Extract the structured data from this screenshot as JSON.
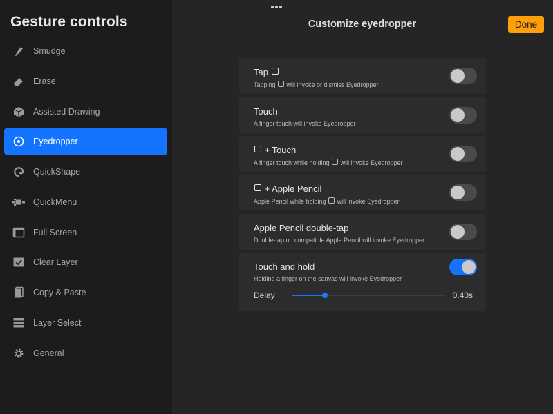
{
  "sidebar": {
    "title": "Gesture controls",
    "items": [
      {
        "label": "Smudge",
        "icon": "smudge-icon"
      },
      {
        "label": "Erase",
        "icon": "eraser-icon"
      },
      {
        "label": "Assisted Drawing",
        "icon": "cube-icon"
      },
      {
        "label": "Eyedropper",
        "icon": "eyedropper-icon",
        "active": true
      },
      {
        "label": "QuickShape",
        "icon": "quickshape-icon"
      },
      {
        "label": "QuickMenu",
        "icon": "quickmenu-icon"
      },
      {
        "label": "Full Screen",
        "icon": "fullscreen-icon"
      },
      {
        "label": "Clear Layer",
        "icon": "clear-layer-icon"
      },
      {
        "label": "Copy & Paste",
        "icon": "copy-paste-icon"
      },
      {
        "label": "Layer Select",
        "icon": "layer-select-icon"
      },
      {
        "label": "General",
        "icon": "gear-icon"
      }
    ]
  },
  "header": {
    "title": "Customize eyedropper",
    "done_label": "Done"
  },
  "options": [
    {
      "title_pre": "Tap",
      "title_sq": true,
      "title_post": "",
      "desc_pre": "Tapping",
      "desc_post": "will invoke or dismiss Eyedropper",
      "desc_sq": true,
      "on": false
    },
    {
      "title_pre": "Touch",
      "title_sq": false,
      "title_post": "",
      "desc_pre": "A finger touch will invoke Eyedropper",
      "desc_post": "",
      "desc_sq": false,
      "on": false
    },
    {
      "title_pre": "",
      "title_sq": true,
      "title_post": "+ Touch",
      "desc_pre": "A finger touch while holding",
      "desc_post": "will invoke Eyedropper",
      "desc_sq": true,
      "on": false
    },
    {
      "title_pre": "",
      "title_sq": true,
      "title_post": "+ Apple Pencil",
      "desc_pre": "Apple Pencil while holding",
      "desc_post": "will invoke Eyedropper",
      "desc_sq": true,
      "on": false
    },
    {
      "title_pre": "Apple Pencil double-tap",
      "title_sq": false,
      "title_post": "",
      "desc_pre": "Double-tap on compatible Apple Pencil will invoke Eyedropper",
      "desc_post": "",
      "desc_sq": false,
      "on": false
    },
    {
      "title_pre": "Touch and hold",
      "title_sq": false,
      "title_post": "",
      "desc_pre": "Holding a finger on the canvas will invoke Eyedropper",
      "desc_post": "",
      "desc_sq": false,
      "on": true
    }
  ],
  "delay": {
    "label": "Delay",
    "value_text": "0.40s",
    "fraction": 0.21
  },
  "colors": {
    "accent": "#1474ff",
    "done": "#ff9f0a"
  }
}
